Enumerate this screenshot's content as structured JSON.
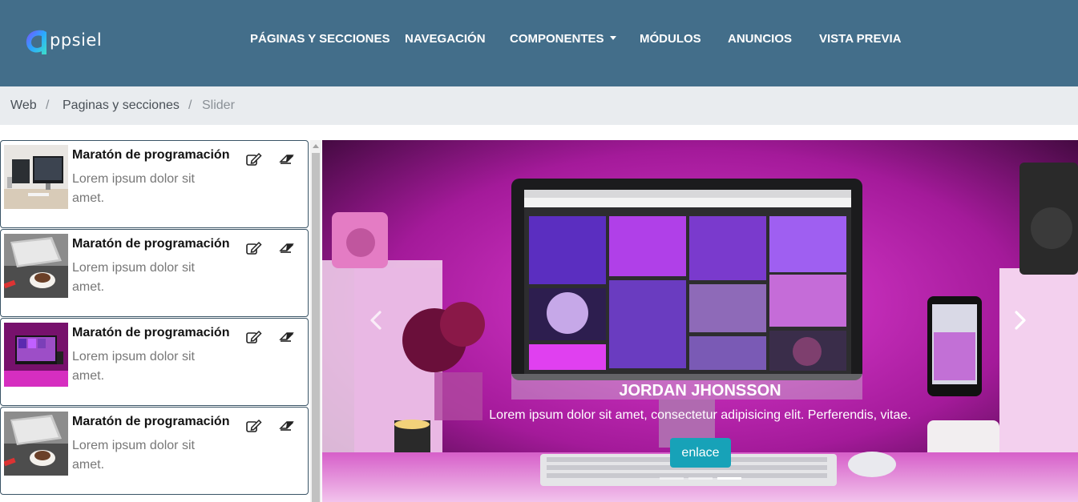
{
  "brand": {
    "logo_text": "ppsiel"
  },
  "nav": {
    "items": [
      {
        "label": "PÁGINAS Y SECCIONES"
      },
      {
        "label": "NAVEGACIÓN"
      },
      {
        "label": "COMPONENTES"
      },
      {
        "label": "MÓDULOS"
      },
      {
        "label": "ANUNCIOS"
      },
      {
        "label": "VISTA PREVIA"
      }
    ]
  },
  "breadcrumb": {
    "items": [
      {
        "label": "Web"
      },
      {
        "label": "Paginas y secciones"
      },
      {
        "label": "Slider"
      }
    ],
    "separator": "/"
  },
  "slides_list": [
    {
      "title": "Maratón de programación",
      "description": "Lorem ipsum dolor sit amet."
    },
    {
      "title": "Maratón de programación",
      "description": "Lorem ipsum dolor sit amet."
    },
    {
      "title": "Maratón de programación",
      "description": "Lorem ipsum dolor sit amet."
    },
    {
      "title": "Maratón de programación",
      "description": "Lorem ipsum dolor sit amet."
    }
  ],
  "carousel": {
    "caption_title": "JORDAN JHONSSON",
    "caption_text": "Lorem ipsum dolor sit amet, consectetur adipisicing elit. Perferendis, vitae.",
    "button_label": "enlace",
    "indicator_count": 3,
    "active_indicator": 2
  },
  "colors": {
    "navbar": "#436e8a",
    "breadcrumb_bg": "#e9ecef",
    "accent_button": "#17a2b8",
    "card_border": "#3a5466"
  }
}
